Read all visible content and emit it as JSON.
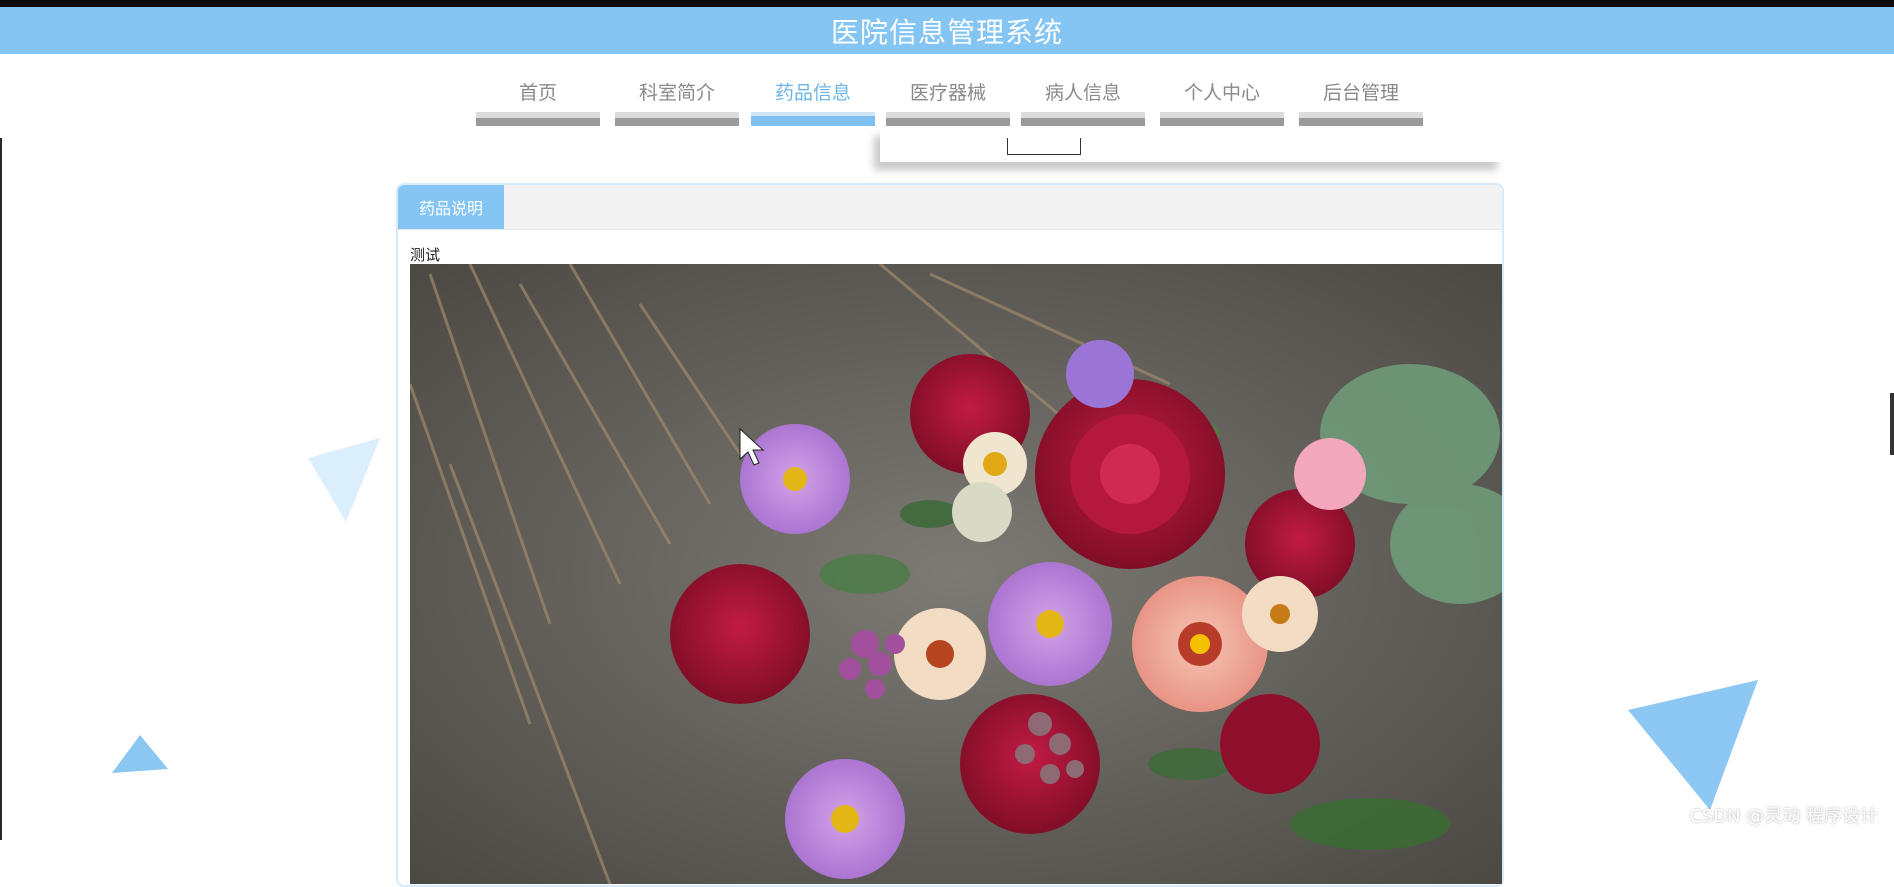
{
  "header": {
    "title": "医院信息管理系统"
  },
  "nav": {
    "items": [
      {
        "label": "首页",
        "active": false
      },
      {
        "label": "科室简介",
        "active": false
      },
      {
        "label": "药品信息",
        "active": true
      },
      {
        "label": "医疗器械",
        "active": false
      },
      {
        "label": "病人信息",
        "active": false
      },
      {
        "label": "个人中心",
        "active": false
      },
      {
        "label": "后台管理",
        "active": false
      }
    ]
  },
  "card": {
    "tab_label": "药品说明",
    "description": "测试"
  },
  "watermark": "CSDN @灵动 程序设计",
  "colors": {
    "header_bg": "#85c5f4",
    "accent": "#6bb4ea",
    "nav_bar_inactive": "#9a9a9a"
  }
}
